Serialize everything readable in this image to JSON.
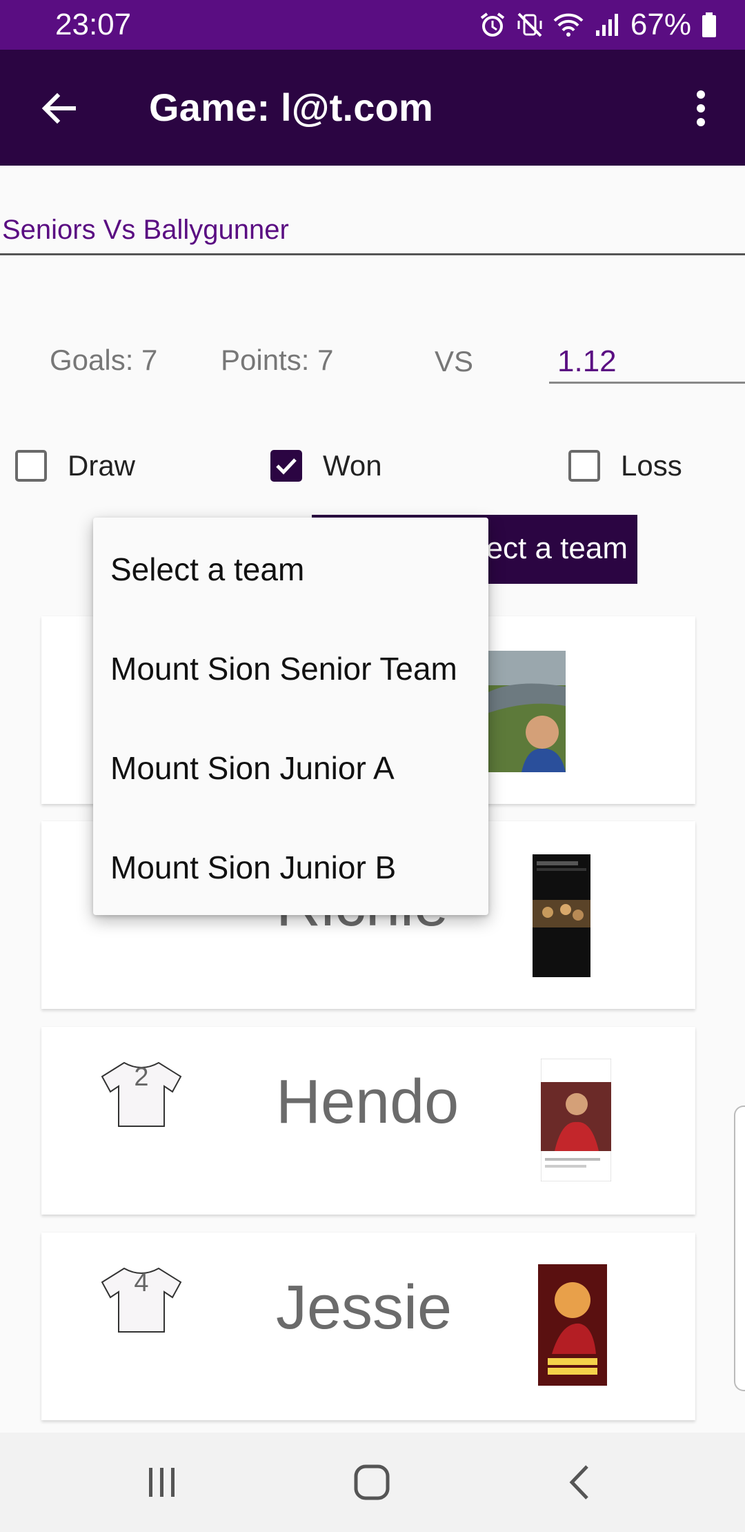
{
  "status_bar": {
    "time": "23:07",
    "battery": "67%"
  },
  "app_bar": {
    "title": "Game: l@t.com"
  },
  "game": {
    "name": "Seniors Vs Ballygunner",
    "goals_label": "Goals: 7",
    "points_label": "Points: 7",
    "vs_label": "VS",
    "opponent_score": "1.12"
  },
  "result": {
    "draw_label": "Draw",
    "won_label": "Won",
    "loss_label": "Loss",
    "draw_checked": false,
    "won_checked": true,
    "loss_checked": false
  },
  "team_spinner": {
    "selected": "Select a team",
    "visible_label": "ect a team",
    "options": [
      "Select a team",
      "Mount Sion Senior Team",
      "Mount Sion Junior A",
      "Mount Sion Junior B"
    ]
  },
  "players": [
    {
      "number": "",
      "name": ""
    },
    {
      "number": "",
      "name": "Richie"
    },
    {
      "number": "2",
      "name": "Hendo"
    },
    {
      "number": "4",
      "name": "Jessie"
    }
  ],
  "colors": {
    "status_bar": "#5a0d82",
    "app_bar": "#2b0542",
    "accent_text": "#5a0d82"
  }
}
